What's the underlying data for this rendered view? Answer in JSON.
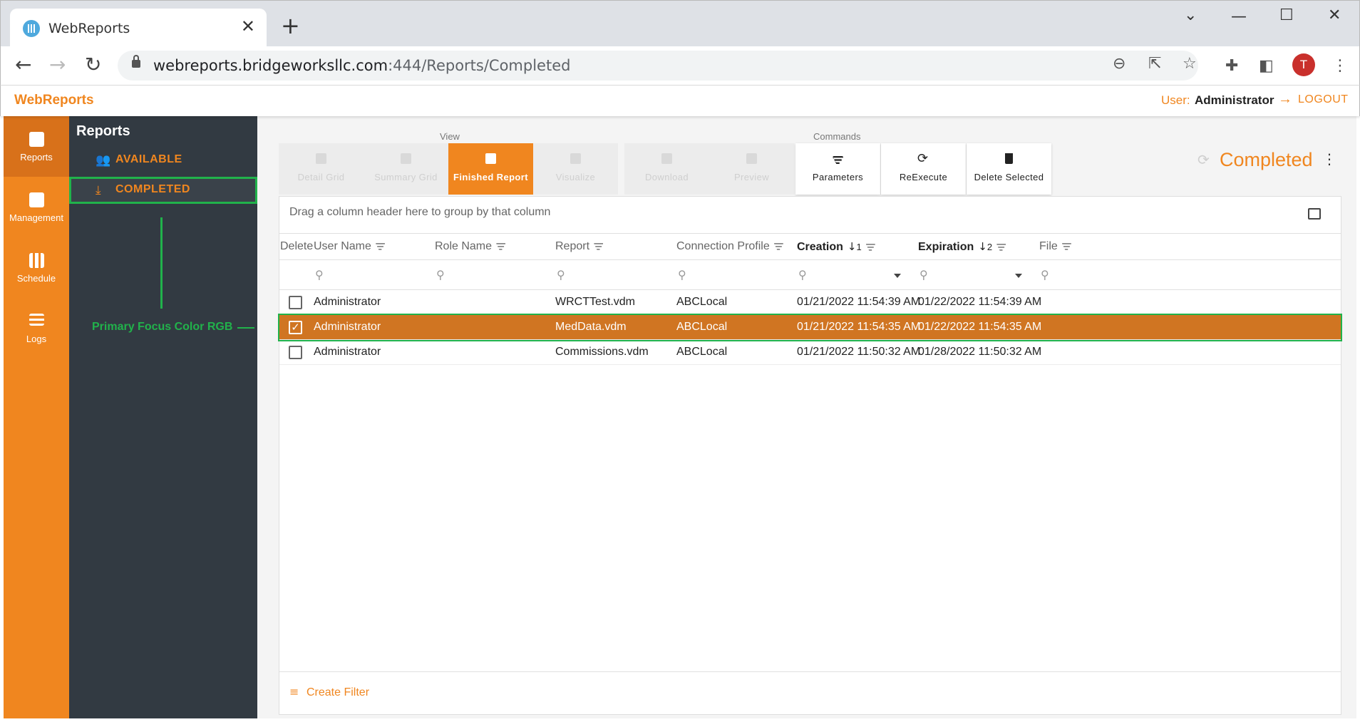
{
  "browser": {
    "tab_title": "WebReports",
    "url_host": "webreports.bridgeworksllc.com",
    "url_path": ":444/Reports/Completed",
    "avatar_letter": "T"
  },
  "app": {
    "brand": "WebReports",
    "user_label": "User:",
    "user_name": "Administrator",
    "logout": "LOGOUT"
  },
  "rail": {
    "items": [
      {
        "label": "Reports",
        "icon": "bar-chart-icon",
        "active": true
      },
      {
        "label": "Management",
        "icon": "account-box-icon"
      },
      {
        "label": "Schedule",
        "icon": "grid-icon"
      },
      {
        "label": "Logs",
        "icon": "list-icon"
      }
    ]
  },
  "sidenav": {
    "title": "Reports",
    "items": [
      {
        "label": "AVAILABLE",
        "icon": "people-icon"
      },
      {
        "label": "COMPLETED",
        "icon": "download-icon",
        "selected": true
      }
    ]
  },
  "annotation": {
    "text": "Primary Focus Color RGB",
    "color": "#21b24b"
  },
  "toolbar": {
    "view_label": "View",
    "commands_label": "Commands",
    "view_buttons": [
      {
        "label": "Detail Grid",
        "state": "disabled"
      },
      {
        "label": "Summary Grid",
        "state": "disabled"
      },
      {
        "label": "Finished Report",
        "state": "active"
      },
      {
        "label": "Visualize",
        "state": "disabled"
      }
    ],
    "command_buttons": [
      {
        "label": "Download",
        "state": "disabled"
      },
      {
        "label": "Preview",
        "state": "disabled"
      },
      {
        "label": "Parameters",
        "state": "enabled"
      },
      {
        "label": "ReExecute",
        "state": "enabled"
      },
      {
        "label": "Delete Selected",
        "state": "enabled"
      }
    ]
  },
  "page_title": "Completed",
  "grid": {
    "group_panel_text": "Drag a column header here to group by that column",
    "columns": [
      {
        "label": "Delete"
      },
      {
        "label": "User Name"
      },
      {
        "label": "Role Name"
      },
      {
        "label": "Report"
      },
      {
        "label": "Connection Profile"
      },
      {
        "label": "Creation",
        "sort": "↓",
        "sort_index": "1"
      },
      {
        "label": "Expiration",
        "sort": "↓",
        "sort_index": "2"
      },
      {
        "label": "File"
      }
    ],
    "rows": [
      {
        "checked": false,
        "user": "Administrator",
        "role": "",
        "report": "WRCTTest.vdm",
        "profile": "ABCLocal",
        "creation": "01/21/2022 11:54:39 AM",
        "expiration": "01/22/2022 11:54:39 AM",
        "file": ""
      },
      {
        "checked": true,
        "user": "Administrator",
        "role": "",
        "report": "MedData.vdm",
        "profile": "ABCLocal",
        "creation": "01/21/2022 11:54:35 AM",
        "expiration": "01/22/2022 11:54:35 AM",
        "file": ""
      },
      {
        "checked": false,
        "user": "Administrator",
        "role": "",
        "report": "Commissions.vdm",
        "profile": "ABCLocal",
        "creation": "01/21/2022 11:50:32 AM",
        "expiration": "01/28/2022 11:50:32 AM",
        "file": ""
      }
    ],
    "create_filter": "Create Filter"
  },
  "colors": {
    "primary": "#f0861f",
    "selected_row": "#d07522",
    "sidenav_bg": "#323a42",
    "highlight": "#21b24b"
  }
}
